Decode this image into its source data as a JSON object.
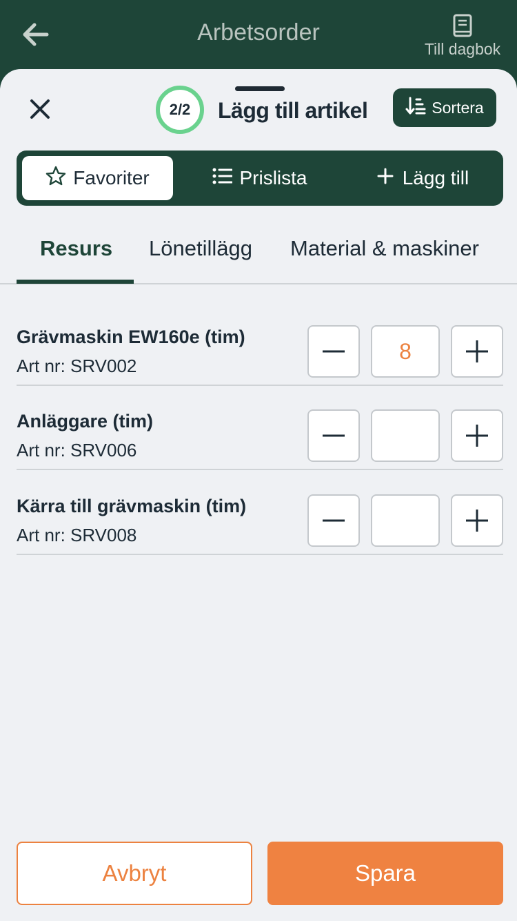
{
  "header": {
    "title": "Arbetsorder",
    "diary_label": "Till dagbok"
  },
  "sheet": {
    "step": "2/2",
    "title": "Lägg till artikel",
    "sort_label": "Sortera"
  },
  "segments": [
    {
      "label": "Favoriter",
      "icon": "star-icon",
      "active": true
    },
    {
      "label": "Prislista",
      "icon": "list-icon",
      "active": false
    },
    {
      "label": "Lägg till",
      "icon": "plus-icon",
      "active": false
    }
  ],
  "tabs": [
    {
      "label": "Resurs",
      "active": true
    },
    {
      "label": "Lönetillägg",
      "active": false
    },
    {
      "label": "Material & maskiner",
      "active": false
    }
  ],
  "items": [
    {
      "name": "Grävmaskin EW160e (tim)",
      "artnr": "Art nr: SRV002",
      "qty": "8"
    },
    {
      "name": "Anläggare (tim)",
      "artnr": "Art nr: SRV006",
      "qty": ""
    },
    {
      "name": "Kärra till grävmaskin (tim)",
      "artnr": "Art nr: SRV008",
      "qty": ""
    }
  ],
  "footer": {
    "cancel_label": "Avbryt",
    "save_label": "Spara"
  },
  "colors": {
    "brand_green": "#1e4538",
    "accent_orange": "#ef8241",
    "step_ring": "#6ad28e"
  }
}
